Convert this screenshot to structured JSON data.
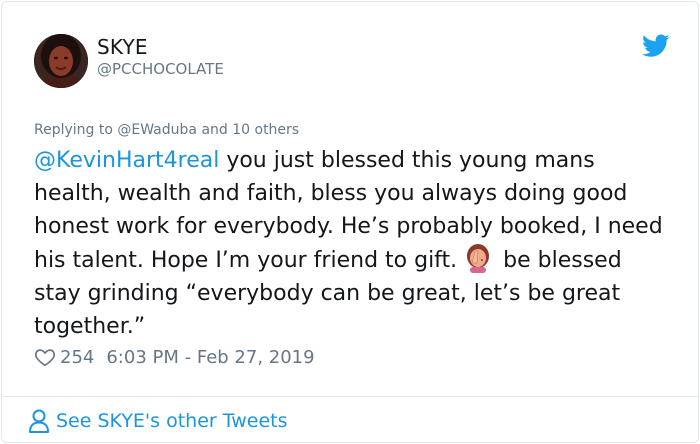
{
  "author": {
    "display_name": "SKYE",
    "handle": "@PCCHOCOLATE",
    "avatar_icon": "avatar-photo"
  },
  "brand": {
    "icon": "twitter-bird-icon",
    "color": "#1da1f2"
  },
  "reply_context": {
    "prefix": "Replying to",
    "mention": "@EWaduba",
    "suffix": "and 10 others"
  },
  "tweet": {
    "mention": "@KevinHart4real",
    "text_part1": " you just blessed this young mans health, wealth and faith, bless you always doing good honest work for everybody. He’s probably booked, I need his talent. Hope I’m your friend to gift.",
    "emoji": "face-palm-woman-emoji",
    "text_part2": "be blessed stay grinding “everybody can be great, let’s be great together.”"
  },
  "meta": {
    "like_icon": "heart-icon",
    "like_count": "254",
    "timestamp": "6:03 PM - Feb 27, 2019"
  },
  "footer": {
    "icon": "person-icon",
    "link_text": "See SKYE's other Tweets"
  },
  "colors": {
    "link": "#1b95e0",
    "secondary_text": "#657786",
    "border": "#e1e8ed"
  }
}
